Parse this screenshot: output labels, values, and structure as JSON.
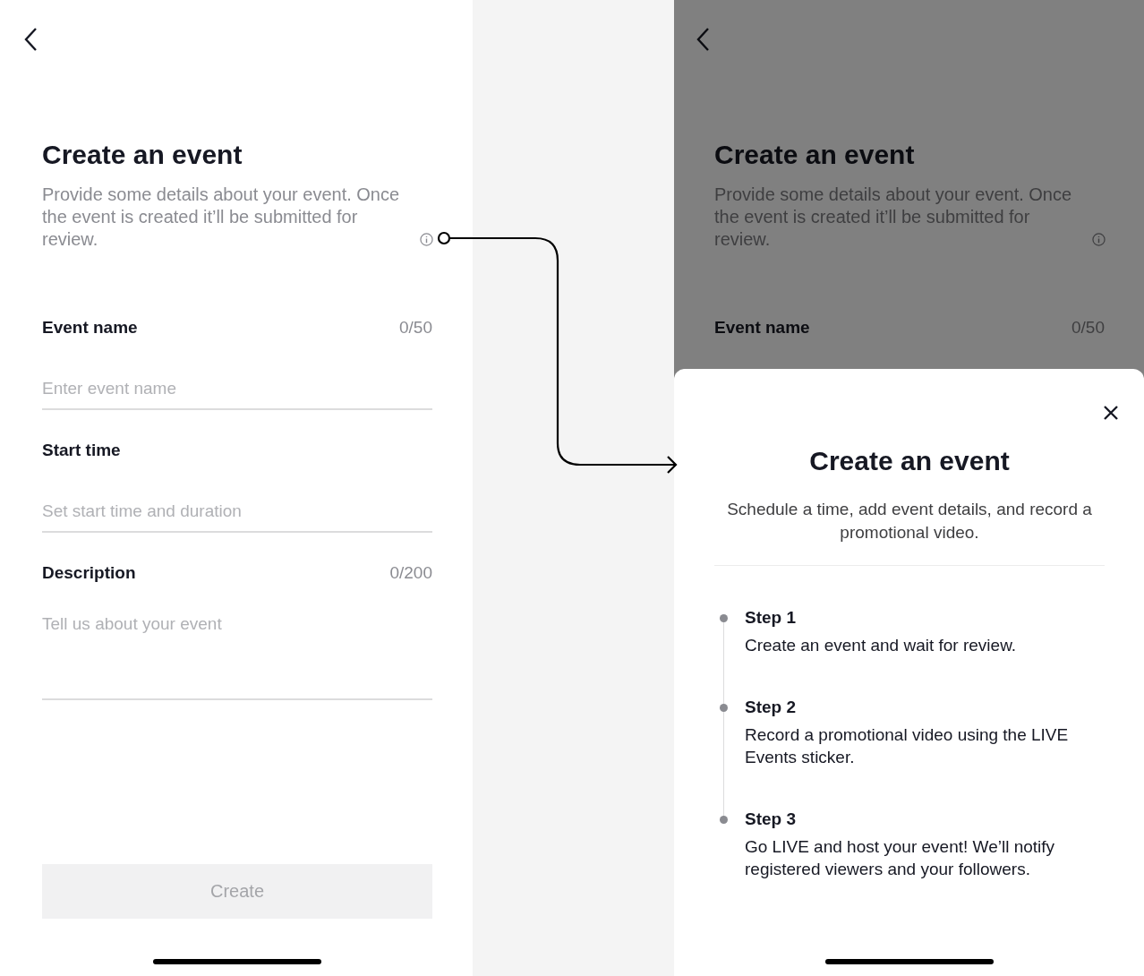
{
  "form_screen": {
    "title": "Create an event",
    "description": "Provide some details about your event. Once the event is created it’ll be submitted for review.",
    "fields": [
      {
        "label": "Event name",
        "counter": "0/50",
        "placeholder": "Enter event name",
        "kind": "single"
      },
      {
        "label": "Start time",
        "placeholder": "Set start time and duration",
        "kind": "single"
      },
      {
        "label": "Description",
        "counter": "0/200",
        "placeholder": "Tell us about your event",
        "kind": "multi"
      }
    ],
    "button": {
      "label": "Create",
      "disabled": true
    }
  },
  "info_screen": {
    "title": "Create an event",
    "description": "Provide some details about your event. Once the event is created it’ll be submitted for review.",
    "field_label": "Event name",
    "counter": "0/50",
    "sheet": {
      "title": "Create an event",
      "description": "Schedule a time, add event details, and record a promotional video.",
      "steps": [
        {
          "title": "Step 1",
          "text": "Create an event and wait for review."
        },
        {
          "title": "Step 2",
          "text": "Record a promotional video using the LIVE Events sticker."
        },
        {
          "title": "Step 3",
          "text": "Go LIVE and host your event! We’ll notify registered viewers and your followers."
        }
      ]
    }
  }
}
